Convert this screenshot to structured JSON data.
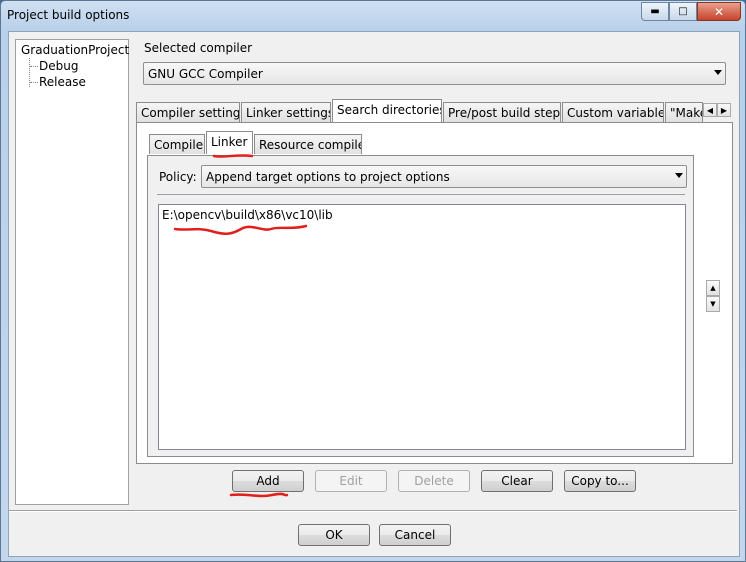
{
  "window": {
    "title": "Project build options"
  },
  "tree": {
    "root": "GraduationProject",
    "children": [
      "Debug",
      "Release"
    ]
  },
  "compiler": {
    "label": "Selected compiler",
    "value": "GNU GCC Compiler"
  },
  "main_tabs": [
    "Compiler settings",
    "Linker settings",
    "Search directories",
    "Pre/post build steps",
    "Custom variables",
    "\"Make"
  ],
  "sub_tabs": [
    "Compiler",
    "Linker",
    "Resource compiler"
  ],
  "policy": {
    "label": "Policy:",
    "value": "Append target options to project options"
  },
  "directories": [
    "E:\\opencv\\build\\x86\\vc10\\lib"
  ],
  "buttons": {
    "add": "Add",
    "edit": "Edit",
    "delete": "Delete",
    "clear": "Clear",
    "copy": "Copy to..."
  },
  "footer": {
    "ok": "OK",
    "cancel": "Cancel"
  },
  "colors": {
    "annotation": "#e0201a"
  }
}
